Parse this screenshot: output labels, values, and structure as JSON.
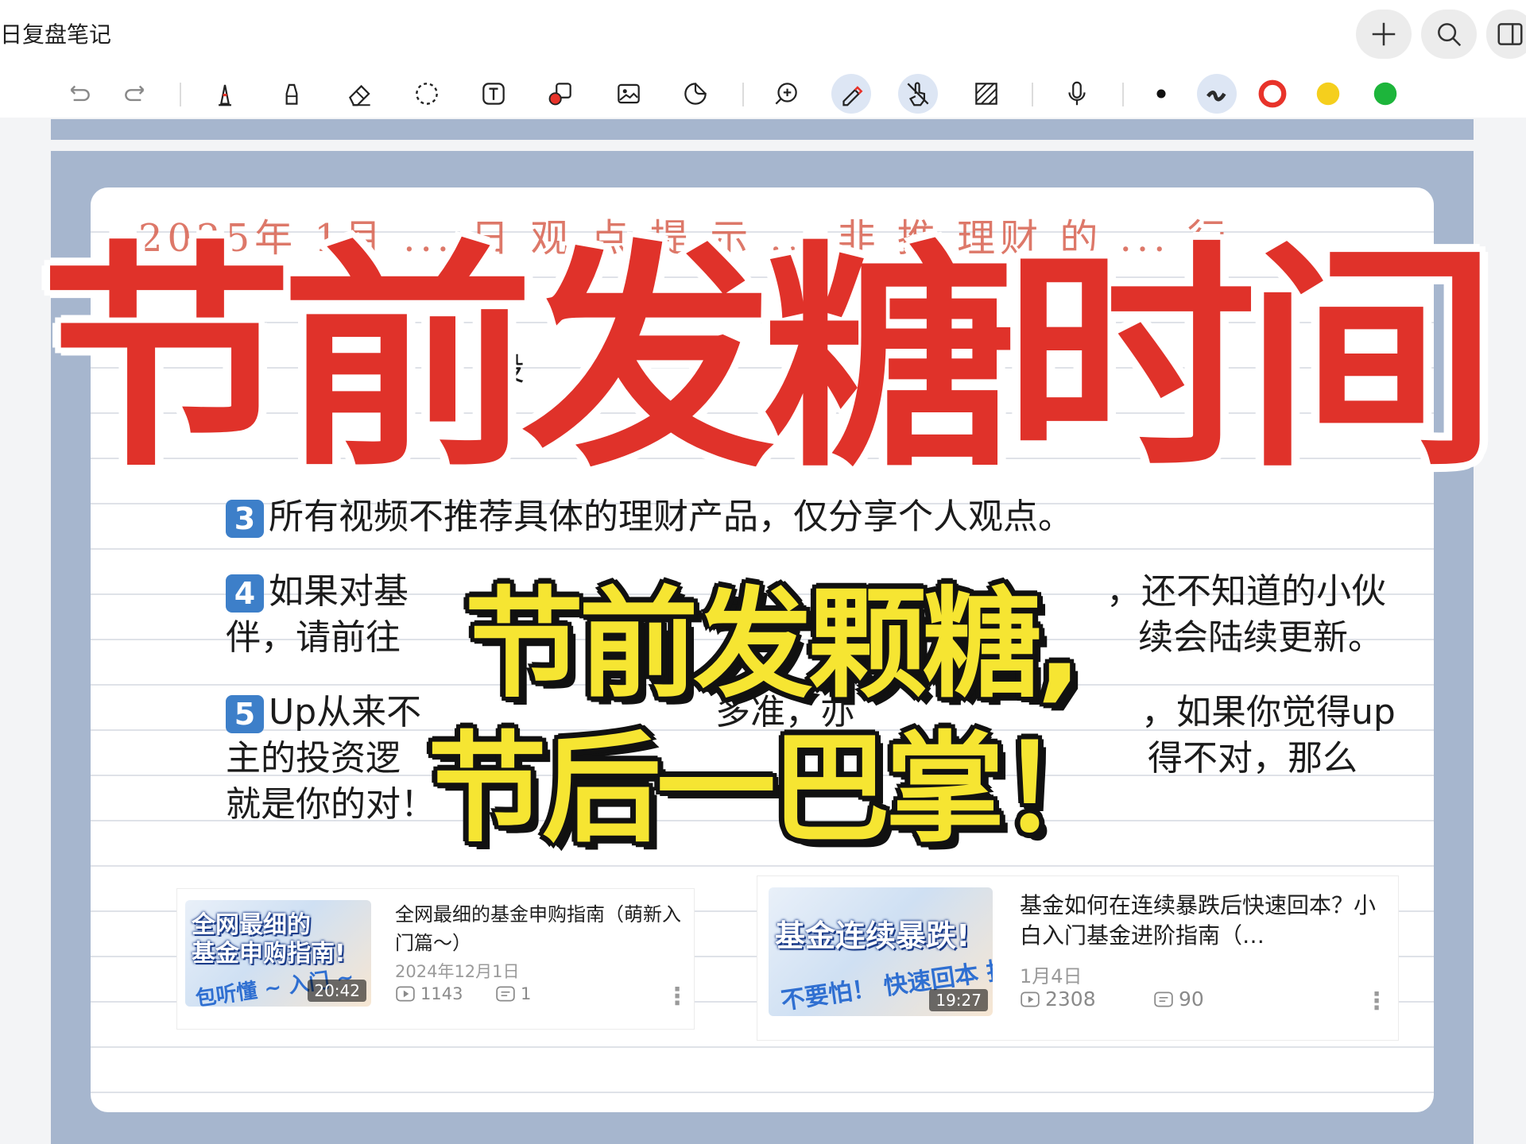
{
  "app": {
    "title": "日复盘笔记"
  },
  "top_actions": [
    "add-icon",
    "search-icon",
    "panel-icon"
  ],
  "toolbar": {
    "tools": [
      "undo-icon",
      "redo-icon",
      "pen-icon",
      "highlighter-icon",
      "eraser-icon",
      "lasso-icon",
      "text-box-icon",
      "shape-icon",
      "image-icon",
      "sticker-icon",
      "zoom-icon",
      "pencil-mode-icon",
      "touch-draw-icon",
      "texture-icon",
      "microphone-icon"
    ],
    "pen_colors": [
      "#111111",
      "#2b2b2b",
      "#e8332a",
      "#f5cf1d",
      "#1db53b"
    ]
  },
  "note": {
    "handwriting": "2025年 1月 ... 日  观 点 提 示 ...  非 推 理财 的 ... 行",
    "partial_fragment": "投",
    "lines": [
      {
        "number": "3",
        "text": "所有视频不推荐具体的理财产品，仅分享个人观点。"
      },
      {
        "number": "4",
        "text": "如果对基",
        "tail": "，还不知道的小伙"
      },
      {
        "text": "伴，请前往",
        "tail": "续会陆续更新。"
      },
      {
        "number": "5",
        "text": "Up从来不",
        "middle": "多准，亦",
        "tail": "，如果你觉得up"
      },
      {
        "text": "主的投资逻",
        "tail": "得不对，那么"
      },
      {
        "text": "就是你的对！"
      }
    ]
  },
  "videos": [
    {
      "thumb_lines": [
        "全网最细的",
        "基金申购指南!"
      ],
      "thumb_sub": "包听懂 ~ 入门 ~",
      "duration": "20:42",
      "title": "全网最细的基金申购指南（萌新入门篇～）",
      "date": "2024年12月1日",
      "plays": "1143",
      "comments": "1"
    },
    {
      "thumb_lines": [
        "基金连续暴跌!"
      ],
      "thumb_sub": "不要怕！ 快速回本 指南",
      "duration": "19:27",
      "title": "基金如何在连续暴跌后快速回本？小白入门基金进阶指南（…",
      "date": "1月4日",
      "plays": "2308",
      "comments": "90"
    }
  ],
  "overlay": {
    "headline": "节前发糖时间",
    "line1": "节前发颗糖,",
    "line2": "节后一巴掌！",
    "headline_color": "#e0322a",
    "caption_color": "#f6e532"
  }
}
